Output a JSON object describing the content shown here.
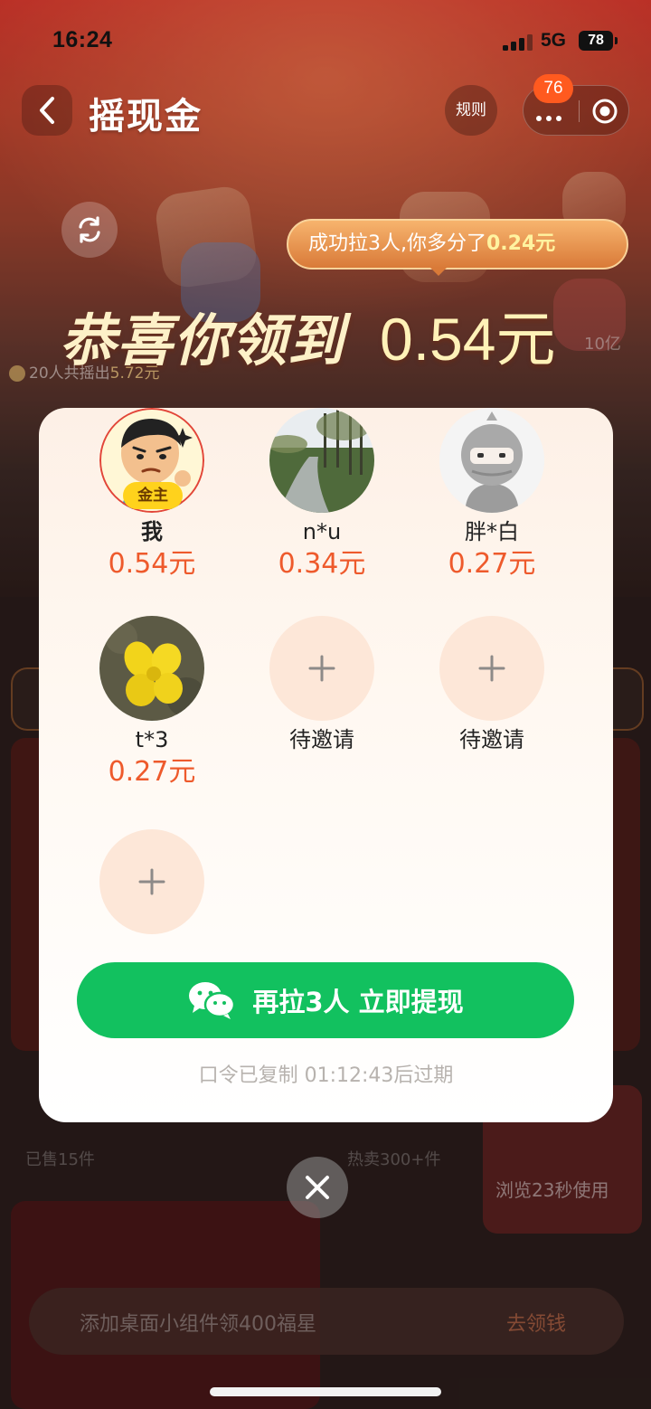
{
  "status_bar": {
    "time": "16:24",
    "network": "5G",
    "battery": "78"
  },
  "nav": {
    "title": "摇现金",
    "rules_label": "规则",
    "badge_count": "76"
  },
  "header": {
    "bubble_prefix": "成功拉3人,你多分了",
    "bubble_amount": "0.24元",
    "congrats_text": "恭喜你领到",
    "amount": "0.54元",
    "summary_prefix": "20人共摇出",
    "summary_amount": "5.72元"
  },
  "members": [
    {
      "name": "我",
      "amount": "0.54元",
      "tag": "金主",
      "avatar": "cartoon-man-avatar"
    },
    {
      "name": "n*u",
      "amount": "0.34元",
      "avatar": "park-path-avatar"
    },
    {
      "name": "胖*白",
      "amount": "0.27元",
      "avatar": "ninja-avatar"
    },
    {
      "name": "t*3",
      "amount": "0.27元",
      "avatar": "yellow-flower-avatar"
    }
  ],
  "pending_invites": [
    {
      "label": "待邀请"
    },
    {
      "label": "待邀请"
    },
    {
      "label": ""
    }
  ],
  "modal": {
    "invite_button_label": "再拉3人 立即提现",
    "expire_text": "口令已复制 01:12:43后过期"
  },
  "background": {
    "widget_banner": "添加桌面小组件领400福星",
    "widget_action": "去领钱",
    "sold_count": "已售15件",
    "hot_sale": "热卖300+件",
    "browse_reward": "浏览23秒使用",
    "side_text": "10亿"
  },
  "colors": {
    "accent_green": "#12c15f",
    "amount_orange": "#ee5a2c",
    "gold_tag": "#ffd21c",
    "badge_orange": "#ff5a1f"
  },
  "icons": {
    "back": "chevron-left-icon",
    "more": "more-dots-icon",
    "close_app": "target-circle-icon",
    "refresh": "refresh-icon",
    "wechat": "wechat-icon",
    "add": "plus-icon",
    "close": "close-icon"
  }
}
